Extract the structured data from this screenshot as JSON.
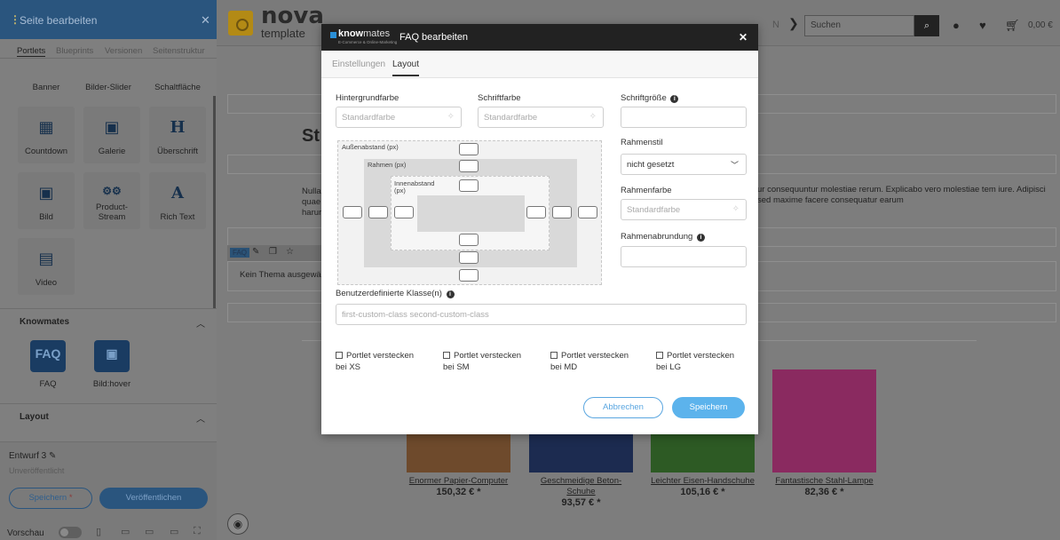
{
  "sidebar": {
    "title": "Seite bearbeiten",
    "tabs": [
      "Portlets",
      "Blueprints",
      "Versionen",
      "Seitenstruktur"
    ],
    "tiles": [
      {
        "label": "Banner",
        "icon": "banner-icon"
      },
      {
        "label": "Bilder-Slider",
        "icon": "slider-icon"
      },
      {
        "label": "Schaltfläche",
        "icon": "button-icon"
      },
      {
        "label": "Countdown",
        "icon": "calendar-icon",
        "glyph": "▦"
      },
      {
        "label": "Galerie",
        "icon": "gallery-icon",
        "glyph": "▣"
      },
      {
        "label": "Überschrift",
        "icon": "heading-icon",
        "glyph": "H"
      },
      {
        "label": "Bild",
        "icon": "image-icon",
        "glyph": "▣"
      },
      {
        "label": "Product-Stream",
        "icon": "product-stream-icon",
        "glyph": "⚙⚙"
      },
      {
        "label": "Rich Text",
        "icon": "rich-text-icon",
        "glyph": "A"
      },
      {
        "label": "Video",
        "icon": "video-icon",
        "glyph": "▤"
      }
    ],
    "knowmates_section": "Knowmates",
    "knowmates_tiles": [
      {
        "label": "FAQ",
        "glyph": "FAQ"
      },
      {
        "label": "Bild:hover",
        "glyph": "▣"
      }
    ],
    "layout_section": "Layout",
    "draft": "Entwurf 3",
    "unpublished": "Unveröffentlicht",
    "save_label": "Speichern",
    "save_marker": "*",
    "publish_label": "Veröffentlichen",
    "preview_label": "Vorschau"
  },
  "page": {
    "logo_title": "nova",
    "logo_sub": "template",
    "nav_text": "N",
    "search_placeholder": "Suchen",
    "cart_total": "0,00 €",
    "heading": "St",
    "text_left": "Nulla quae harur",
    "text_right": "ur consequuntur molestiae rerum. Explicabo vero molestiae tem iure. Adipisci sed maxime facere consequatur earum",
    "faq_tag": "FAQ",
    "faq_body": "Kein Thema ausgewähl",
    "products": [
      {
        "name": "Enormer Papier-Computer",
        "price": "150,32 € *",
        "color": "#6e4a2c"
      },
      {
        "name": "Geschmeidige Beton-Schuhe",
        "price": "93,57 € *",
        "color": "#1c2b50"
      },
      {
        "name": "Leichter Eisen-Handschuhe",
        "price": "105,16 € *",
        "color": "#2d5a24"
      },
      {
        "name": "Fantastische Stahl-Lampe",
        "price": "82,36 € *",
        "color": "#8a2a60"
      }
    ]
  },
  "modal": {
    "brand": "know",
    "brand_light": "mates",
    "brand_sub": "E-Commerce & Online-Marketing",
    "title": "FAQ bearbeiten",
    "tabs": [
      "Einstellungen",
      "Layout"
    ],
    "active_tab": "Layout",
    "bg_color_label": "Hintergrundfarbe",
    "bg_color_placeholder": "Standardfarbe",
    "font_color_label": "Schriftfarbe",
    "font_color_placeholder": "Standardfarbe",
    "font_size_label": "Schriftgröße",
    "border_style_label": "Rahmenstil",
    "border_style_value": "nicht gesetzt",
    "border_color_label": "Rahmenfarbe",
    "border_color_placeholder": "Standardfarbe",
    "border_radius_label": "Rahmenabrundung",
    "box_margin_label": "Außenabstand (px)",
    "box_border_label": "Rahmen (px)",
    "box_padding_label": "Innenabstand (px)",
    "custom_class_label": "Benutzerdefinierte Klasse(n)",
    "custom_class_placeholder": "first-custom-class second-custom-class",
    "hide_options": [
      {
        "line1": "Portlet verstecken",
        "line2": "bei XS"
      },
      {
        "line1": "Portlet verstecken",
        "line2": "bei SM"
      },
      {
        "line1": "Portlet verstecken",
        "line2": "bei MD"
      },
      {
        "line1": "Portlet verstecken",
        "line2": "bei LG"
      }
    ],
    "cancel_label": "Abbrechen",
    "save_label": "Speichern"
  },
  "colors": {
    "accent": "#5cb3ec",
    "sidebar_header": "#2a557e",
    "modal_header": "#222222"
  }
}
